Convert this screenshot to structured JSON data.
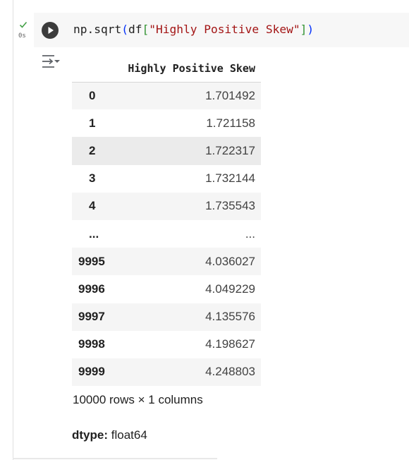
{
  "cell": {
    "exec_time": "0s",
    "code": {
      "fn": "np.sqrt",
      "open_paren": "(",
      "var": "df",
      "open_bracket": "[",
      "key": "\"Highly Positive Skew\"",
      "close_bracket": "]",
      "close_paren": ")"
    }
  },
  "output": {
    "column_header": "Highly Positive Skew",
    "rows": [
      {
        "index": "0",
        "value": "1.701492"
      },
      {
        "index": "1",
        "value": "1.721158"
      },
      {
        "index": "2",
        "value": "1.722317"
      },
      {
        "index": "3",
        "value": "1.732144"
      },
      {
        "index": "4",
        "value": "1.735543"
      },
      {
        "index": "...",
        "value": "..."
      },
      {
        "index": "9995",
        "value": "4.036027"
      },
      {
        "index": "9996",
        "value": "4.049229"
      },
      {
        "index": "9997",
        "value": "4.135576"
      },
      {
        "index": "9998",
        "value": "4.198627"
      },
      {
        "index": "9999",
        "value": "4.248803"
      }
    ],
    "shape_text": "10000 rows × 1 columns",
    "dtype_label": "dtype:",
    "dtype_value": "float64"
  },
  "colors": {
    "check": "#43a047",
    "run_button": "#3c3c3c",
    "paren": "#0431fa",
    "bracket": "#319331",
    "string": "#a31515"
  },
  "icons": [
    "check-icon",
    "run-play-icon",
    "output-actions-icon"
  ]
}
